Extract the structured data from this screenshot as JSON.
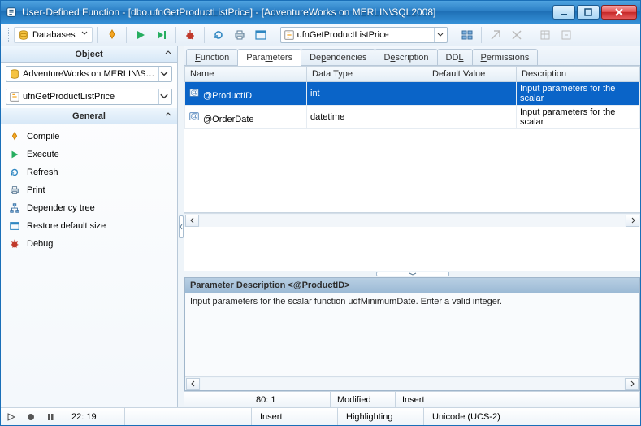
{
  "window": {
    "title": "User-Defined Function - [dbo.ufnGetProductListPrice] - [AdventureWorks on MERLIN\\SQL2008]"
  },
  "toolbar": {
    "databases_label": "Databases",
    "function_name": "ufnGetProductListPrice"
  },
  "sidebar": {
    "object_header": "Object",
    "db_combo": "AdventureWorks on MERLIN\\SQL2008",
    "func_combo": "ufnGetProductListPrice",
    "general_header": "General",
    "items": [
      {
        "label": "Compile"
      },
      {
        "label": "Execute"
      },
      {
        "label": "Refresh"
      },
      {
        "label": "Print"
      },
      {
        "label": "Dependency tree"
      },
      {
        "label": "Restore default size"
      },
      {
        "label": "Debug"
      }
    ]
  },
  "tabs": [
    "Function",
    "Parameters",
    "Dependencies",
    "Description",
    "DDL",
    "Permissions"
  ],
  "active_tab": 1,
  "grid": {
    "headers": [
      "Name",
      "Data Type",
      "Default Value",
      "Description"
    ],
    "rows": [
      {
        "name": "@ProductID",
        "type": "int",
        "default": "",
        "desc": "Input parameters for the scalar",
        "selected": true
      },
      {
        "name": "@OrderDate",
        "type": "datetime",
        "default": "",
        "desc": "Input parameters for the scalar",
        "selected": false
      }
    ]
  },
  "desc_panel": {
    "title": "Parameter Description <@ProductID>",
    "body": "Input parameters for the scalar function udfMinimumDate. Enter a valid integer."
  },
  "inner_status": {
    "pos": "80:  1",
    "mod": "Modified",
    "ins": "Insert"
  },
  "outer_status": {
    "pos": "22:  19",
    "ins": "Insert",
    "hl": "Highlighting",
    "enc": "Unicode (UCS-2)"
  }
}
